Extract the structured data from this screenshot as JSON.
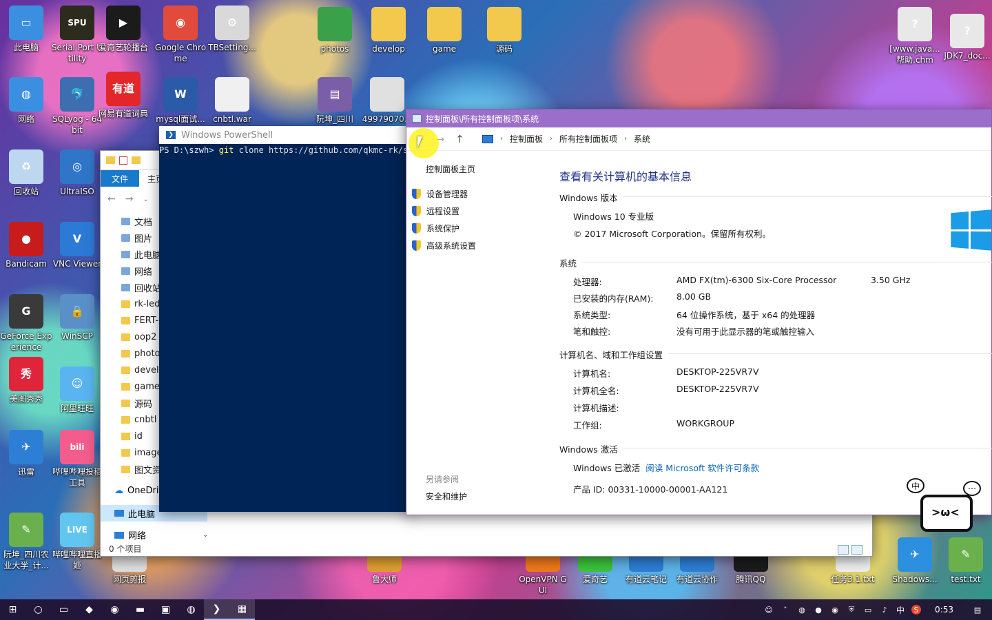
{
  "desktop": {
    "icons": [
      {
        "label": "此电脑",
        "icon": "computer-icon",
        "color": "#3b8fe0",
        "glyph": "▭"
      },
      {
        "label": "Serial Port Utility",
        "icon": "serial-port-icon",
        "color": "#2b2b1e",
        "glyph": "SPU"
      },
      {
        "label": "爱奇艺轮播台",
        "icon": "iqiyi-carousel-icon",
        "color": "#1b1b1b",
        "glyph": "▶"
      },
      {
        "label": "Google Chrome",
        "icon": "chrome-icon",
        "color": "#e24b3b",
        "glyph": "◉"
      },
      {
        "label": "TBSetting...",
        "icon": "settings-file-icon",
        "color": "#d9d9d9",
        "glyph": "⚙"
      },
      {
        "label": "网络",
        "icon": "network-icon",
        "color": "#3b8fe0",
        "glyph": "◍"
      },
      {
        "label": "SQLyog - 64 bit",
        "icon": "sqlyog-icon",
        "color": "#3d6fb0",
        "glyph": "🐬"
      },
      {
        "label": "网易有道词典",
        "icon": "youdao-dict-icon",
        "color": "#e3262a",
        "glyph": "有道"
      },
      {
        "label": "mysql面试...",
        "icon": "word-doc-icon",
        "color": "#2b5aa8",
        "glyph": "W"
      },
      {
        "label": "cnbtl.war",
        "icon": "file-icon",
        "color": "#f0f0f0",
        "glyph": ""
      },
      {
        "label": "回收站",
        "icon": "recycle-bin-icon",
        "color": "#bcd7ef",
        "glyph": "♻"
      },
      {
        "label": "UltraISO",
        "icon": "ultraiso-icon",
        "color": "#3076c8",
        "glyph": "◎"
      },
      {
        "label": "Bandicam",
        "icon": "bandicam-icon",
        "color": "#c81b1b",
        "glyph": "●"
      },
      {
        "label": "VNC Viewer",
        "icon": "vnc-icon",
        "color": "#2c7ad6",
        "glyph": "V"
      },
      {
        "label": "GeForce Experience",
        "icon": "geforce-icon",
        "color": "#3a3a3a",
        "glyph": "G"
      },
      {
        "label": "WinSCP",
        "icon": "winscp-icon",
        "color": "#5a8fc8",
        "glyph": "🔒"
      },
      {
        "label": "美图秀秀",
        "icon": "meitu-icon",
        "color": "#e0243a",
        "glyph": "秀"
      },
      {
        "label": "阿里旺旺",
        "icon": "aliwangwang-icon",
        "color": "#5ab4f0",
        "glyph": "☺"
      },
      {
        "label": "迅雷",
        "icon": "xunlei-icon",
        "color": "#2d7fd6",
        "glyph": "✈"
      },
      {
        "label": "哔哩哔哩投稿工具",
        "icon": "bilibili-upload-icon",
        "color": "#f25d8e",
        "glyph": "bili"
      },
      {
        "label": "阮坤_四川农业大学_计...",
        "icon": "notepad-icon",
        "color": "#6ab04c",
        "glyph": "✎"
      },
      {
        "label": "哔哩哔哩直播姬",
        "icon": "bilibili-live-icon",
        "color": "#60c6f0",
        "glyph": "LIVE"
      },
      {
        "label": "photos",
        "icon": "folder-icon",
        "color": "#3aa04a",
        "glyph": ""
      },
      {
        "label": "develop",
        "icon": "folder-icon",
        "color": "#f2c94c",
        "glyph": ""
      },
      {
        "label": "game",
        "icon": "folder-icon",
        "color": "#f2c94c",
        "glyph": ""
      },
      {
        "label": "源码",
        "icon": "folder-icon",
        "color": "#f2c94c",
        "glyph": ""
      },
      {
        "label": "[www.java...帮助.chm",
        "icon": "chm-help-icon",
        "color": "#e8e8e8",
        "glyph": "?"
      },
      {
        "label": "JDK7_doc...",
        "icon": "chm-help-icon",
        "color": "#e8e8e8",
        "glyph": "?"
      },
      {
        "label": "阮坤_四川农...",
        "icon": "winrar-icon",
        "color": "#7a5fa8",
        "glyph": "▤"
      },
      {
        "label": "49979070...",
        "icon": "image-file-icon",
        "color": "#e0e0e0",
        "glyph": ""
      },
      {
        "label": "网页剪报",
        "icon": "web-clip-icon",
        "color": "#e0e0e0",
        "glyph": ""
      },
      {
        "label": "鲁大师",
        "icon": "ludashi-icon",
        "color": "#e0a030",
        "glyph": ""
      },
      {
        "label": "OpenVPN GUI",
        "icon": "openvpn-icon",
        "color": "#f07a1a",
        "glyph": ""
      },
      {
        "label": "爱奇艺",
        "icon": "iqiyi-icon",
        "color": "#3bc43b",
        "glyph": ""
      },
      {
        "label": "有道云笔记",
        "icon": "youdao-note-icon",
        "color": "#2d7fd6",
        "glyph": ""
      },
      {
        "label": "有道云协作",
        "icon": "youdao-collab-icon",
        "color": "#2d7fd6",
        "glyph": ""
      },
      {
        "label": "腾讯QQ",
        "icon": "qq-icon",
        "color": "#1b1b1b",
        "glyph": ""
      },
      {
        "label": "任务3.1.txt",
        "icon": "txt-file-icon",
        "color": "#f0f0f0",
        "glyph": ""
      },
      {
        "label": "Shadows...",
        "icon": "shadowsocks-icon",
        "color": "#2d8fe0",
        "glyph": "✈"
      },
      {
        "label": "test.txt",
        "icon": "notepad-icon",
        "color": "#6ab04c",
        "glyph": "✎"
      }
    ]
  },
  "explorer": {
    "ribbon_file": "文件",
    "ribbon_home": "主页",
    "tree": [
      "文档",
      "图片",
      "此电脑",
      "网络",
      "回收站",
      "rk-led",
      "FERT-",
      "oop2",
      "photo",
      "devel",
      "game",
      "源码",
      "cnbtl",
      "id",
      "image",
      "图文资"
    ],
    "onedrive": "OneDri",
    "thispc": "此电脑",
    "network": "网络",
    "status": "0 个项目"
  },
  "powershell": {
    "title": "Windows PowerShell",
    "prompt": "PS D:\\szwh> ",
    "cmd": "git",
    "args": " clone https://github.com/qkmc-rk/sz"
  },
  "system": {
    "title": "控制面板\\所有控制面板项\\系统",
    "breadcrumb": [
      "控制面板",
      "所有控制面板项",
      "系统"
    ],
    "left": {
      "home": "控制面板主页",
      "items": [
        "设备管理器",
        "远程设置",
        "系统保护",
        "高级系统设置"
      ],
      "see_also": "另请参阅",
      "security": "安全和维护"
    },
    "heading": "查看有关计算机的基本信息",
    "edition_header": "Windows 版本",
    "edition": "Windows 10 专业版",
    "copyright": "© 2017 Microsoft Corporation。保留所有权利。",
    "system_header": "系统",
    "processor_label": "处理器:",
    "processor_value": "AMD FX(tm)-6300 Six-Core Processor",
    "processor_speed": "3.50 GHz",
    "ram_label": "已安装的内存(RAM):",
    "ram_value": "8.00 GB",
    "type_label": "系统类型:",
    "type_value": "64 位操作系统，基于 x64 的处理器",
    "pen_label": "笔和触控:",
    "pen_value": "没有可用于此显示器的笔或触控输入",
    "computer_header": "计算机名、域和工作组设置",
    "name_label": "计算机名:",
    "name_value": "DESKTOP-225VR7V",
    "fullname_label": "计算机全名:",
    "fullname_value": "DESKTOP-225VR7V",
    "desc_label": "计算机描述:",
    "workgroup_label": "工作组:",
    "workgroup_value": "WORKGROUP",
    "activation_header": "Windows 激活",
    "activated": "Windows 已激活",
    "license_link": "阅读 Microsoft 软件许可条款",
    "product_id": "产品 ID: 00331-10000-00001-AA121"
  },
  "mascot": {
    "bubble1": "中",
    "bubble2": "⋯"
  },
  "taskbar": {
    "clock": "0:53",
    "ime": "中",
    "apps": [
      {
        "name": "start-icon",
        "glyph": "⊞"
      },
      {
        "name": "search-icon",
        "glyph": "○"
      },
      {
        "name": "task-view-icon",
        "glyph": "▭"
      },
      {
        "name": "store-icon",
        "glyph": "◆"
      },
      {
        "name": "chrome-taskbar-icon",
        "glyph": "◉"
      },
      {
        "name": "file-explorer-icon",
        "glyph": "▬"
      },
      {
        "name": "iqiyi-taskbar-icon",
        "glyph": "▣"
      },
      {
        "name": "recorder-icon",
        "glyph": "◍"
      },
      {
        "name": "powershell-taskbar-icon",
        "glyph": "❯"
      },
      {
        "name": "control-panel-taskbar-icon",
        "glyph": "▦"
      }
    ]
  }
}
